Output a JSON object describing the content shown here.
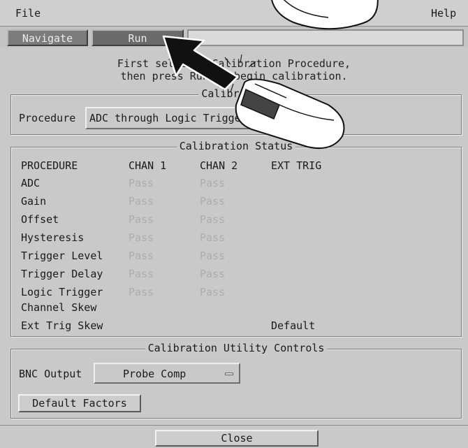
{
  "menu": {
    "file": "File",
    "help": "Help"
  },
  "tabs": {
    "navigate": "Navigate",
    "run": "Run"
  },
  "instructions": {
    "line1": "First select a Calibration Procedure,",
    "line2": "then press Run to begin calibration."
  },
  "calibration": {
    "title": "Calibration",
    "procedure_label": "Procedure",
    "procedure_value": "ADC through Logic Trigger"
  },
  "status": {
    "title": "Calibration Status",
    "headers": [
      "PROCEDURE",
      "CHAN 1",
      "CHAN 2",
      "EXT TRIG"
    ],
    "rows": [
      [
        "ADC",
        "Pass",
        "Pass",
        ""
      ],
      [
        "Gain",
        "Pass",
        "Pass",
        ""
      ],
      [
        "Offset",
        "Pass",
        "Pass",
        ""
      ],
      [
        "Hysteresis",
        "Pass",
        "Pass",
        ""
      ],
      [
        "Trigger Level",
        "Pass",
        "Pass",
        ""
      ],
      [
        "Trigger Delay",
        "Pass",
        "Pass",
        ""
      ],
      [
        "Logic Trigger",
        "Pass",
        "Pass",
        ""
      ],
      [
        "Channel Skew",
        "",
        "",
        ""
      ],
      [
        "Ext Trig Skew",
        "",
        "",
        "Default"
      ]
    ]
  },
  "utility": {
    "title": "Calibration Utility Controls",
    "bnc_label": "BNC Output",
    "bnc_value": "Probe Comp",
    "default_factors": "Default Factors"
  },
  "close": "Close",
  "icons": {
    "cursor": "arrow-cursor-icon",
    "mouse": "mouse-click-icon"
  }
}
